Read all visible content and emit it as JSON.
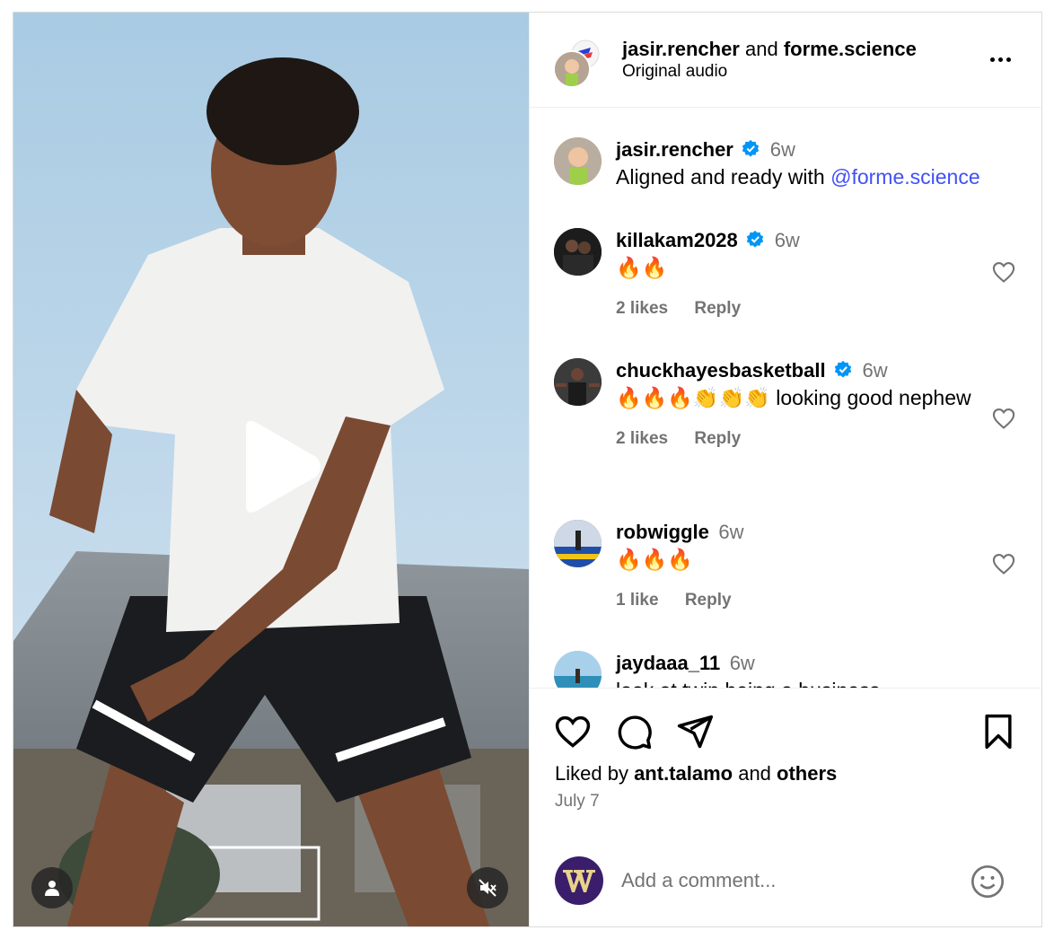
{
  "header": {
    "user1": "jasir.rencher",
    "and_text": "and",
    "user2": "forme.science",
    "audio": "Original audio",
    "more_icon": "more-horizontal-icon"
  },
  "caption": {
    "username": "jasir.rencher",
    "time": "6w",
    "text": "Aligned and ready with ",
    "mention": "@forme.science"
  },
  "comments": [
    {
      "username": "killakam2028",
      "verified": true,
      "time": "6w",
      "text": "🔥🔥",
      "likes": "2 likes",
      "reply": "Reply"
    },
    {
      "username": "chuckhayesbasketball",
      "verified": true,
      "time": "6w",
      "text": "🔥🔥🔥👏👏👏 looking good nephew",
      "likes": "2 likes",
      "reply": "Reply"
    },
    {
      "username": "robwiggle",
      "verified": false,
      "time": "6w",
      "text": "🔥🔥🔥",
      "likes": "1 like",
      "reply": "Reply"
    },
    {
      "username": "jaydaaa_11",
      "verified": false,
      "time": "6w",
      "text": "look at twin being a business"
    }
  ],
  "actions": {
    "liked_prefix": "Liked by ",
    "liked_user": "ant.talamo",
    "liked_mid": " and ",
    "liked_suffix": "others",
    "date": "July 7"
  },
  "add_comment": {
    "placeholder": "Add a comment..."
  },
  "colors": {
    "verified": "#0095f6",
    "mention": "#4150f7",
    "muted_text": "#737373"
  }
}
